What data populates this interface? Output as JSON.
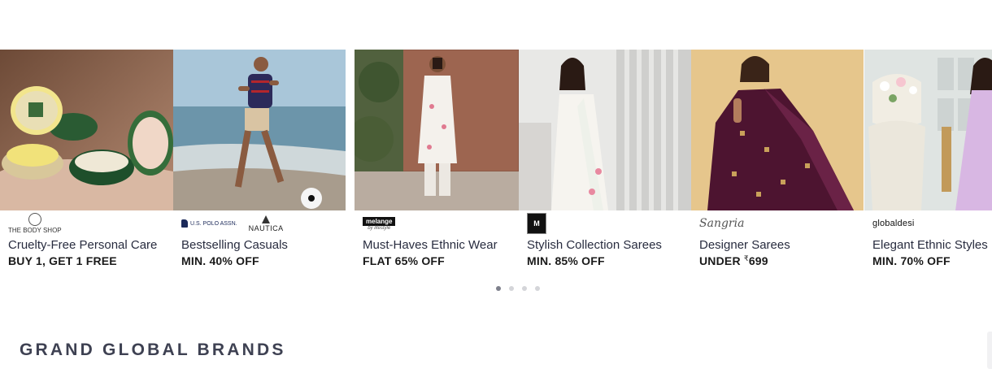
{
  "carousel": {
    "cards": [
      {
        "brands": [
          "THE BODY SHOP"
        ],
        "title": "Cruelty-Free Personal Care",
        "offer": "BUY 1, GET 1 FREE"
      },
      {
        "brands": [
          "U.S. POLO ASSN.",
          "NAUTICA"
        ],
        "title": "Bestselling Casuals",
        "offer": "MIN. 40% OFF"
      },
      {
        "brands": [
          "melange",
          "by lifestyle"
        ],
        "title": "Must-Haves Ethnic Wear",
        "offer": "FLAT 65% OFF"
      },
      {
        "brands": [
          "M"
        ],
        "title": "Stylish Collection Sarees",
        "offer": "MIN. 85% OFF"
      },
      {
        "brands": [
          "Sangria"
        ],
        "title": "Designer Sarees",
        "offer_prefix": "UNDER ",
        "currency": "₹",
        "offer_amount": "699"
      },
      {
        "brands": [
          "globaldesi"
        ],
        "title": "Elegant Ethnic Styles",
        "offer": "MIN. 70% OFF"
      }
    ],
    "dots_total": 4,
    "dots_active": 0
  },
  "section": {
    "title": "GRAND GLOBAL BRANDS"
  },
  "colors": {
    "text": "#282c3f",
    "heading": "#3e4152",
    "dot_active": "#7e808c",
    "dot": "#d4d5d9"
  }
}
